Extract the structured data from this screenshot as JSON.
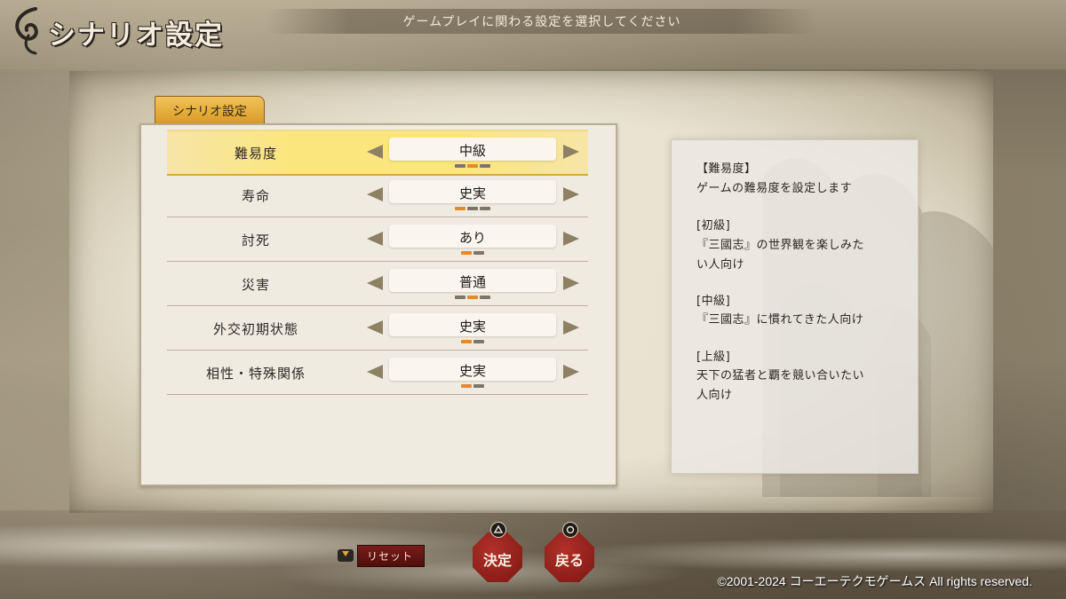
{
  "header": {
    "title": "シナリオ設定",
    "subtitle": "ゲームプレイに関わる設定を選択してください"
  },
  "tab": {
    "label": "シナリオ設定"
  },
  "settings": [
    {
      "label": "難易度",
      "value": "中級",
      "pips_total": 3,
      "pip_active": 2,
      "selected": true
    },
    {
      "label": "寿命",
      "value": "史実",
      "pips_total": 3,
      "pip_active": 1,
      "selected": false
    },
    {
      "label": "討死",
      "value": "あり",
      "pips_total": 2,
      "pip_active": 1,
      "selected": false
    },
    {
      "label": "災害",
      "value": "普通",
      "pips_total": 3,
      "pip_active": 2,
      "selected": false
    },
    {
      "label": "外交初期状態",
      "value": "史実",
      "pips_total": 2,
      "pip_active": 1,
      "selected": false
    },
    {
      "label": "相性・特殊関係",
      "value": "史実",
      "pips_total": 2,
      "pip_active": 1,
      "selected": false
    }
  ],
  "description": {
    "lines": [
      "【難易度】",
      "ゲームの難易度を設定します",
      "[初級]",
      "『三國志』の世界観を楽しみた",
      "い人向け",
      "[中級]",
      "『三國志』に慣れてきた人向け",
      "[上級]",
      "天下の猛者と覇を競い合いたい",
      "人向け"
    ]
  },
  "footer": {
    "reset_label": "リセット",
    "confirm_label": "決定",
    "back_label": "戻る",
    "copyright": "©2001-2024 コーエーテクモゲームス All rights reserved."
  },
  "icons": {
    "confirm_button_icon": "triangle-icon",
    "back_button_icon": "circle-icon",
    "reset_button_icon": "touchpad-icon"
  },
  "colors": {
    "accent_orange": "#e38a2a",
    "tab_gold": "#e3a93a",
    "button_red": "#9a231d",
    "selected_row": "#fbe37a"
  }
}
